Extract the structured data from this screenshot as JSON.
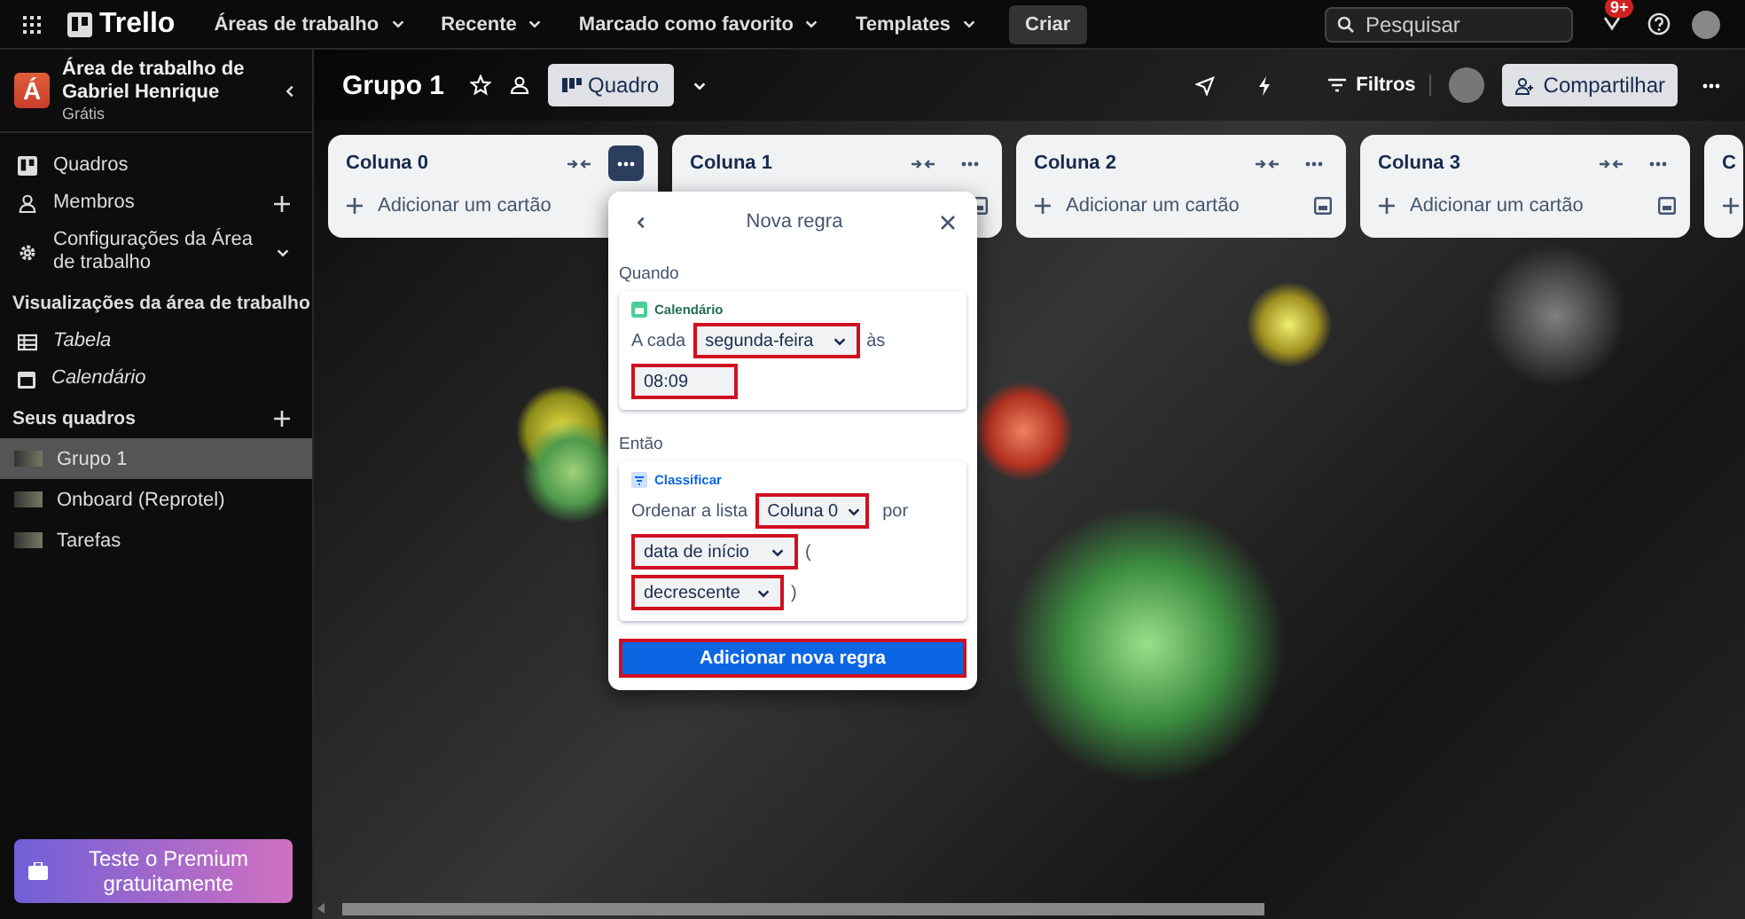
{
  "topbar": {
    "logo": "Trello",
    "menus": [
      {
        "label": "Áreas de trabalho"
      },
      {
        "label": "Recente"
      },
      {
        "label": "Marcado como favorito"
      },
      {
        "label": "Templates"
      }
    ],
    "create": "Criar",
    "search": {
      "placeholder": "Pesquisar"
    },
    "notification_badge": "9+"
  },
  "sidebar": {
    "workspace": {
      "initial": "Á",
      "name": "Área de trabalho de Gabriel Henrique",
      "plan": "Grátis"
    },
    "items": [
      {
        "label": "Quadros"
      },
      {
        "label": "Membros"
      },
      {
        "label": "Configurações da Área de trabalho"
      }
    ],
    "views_title": "Visualizações da área de trabalho",
    "views": [
      {
        "label": "Tabela"
      },
      {
        "label": "Calendário"
      }
    ],
    "boards_title": "Seus quadros",
    "boards": [
      {
        "label": "Grupo 1",
        "selected": true
      },
      {
        "label": "Onboard (Reprotel)",
        "selected": false
      },
      {
        "label": "Tarefas",
        "selected": false
      }
    ],
    "premium": "Teste o Premium gratuitamente"
  },
  "board": {
    "title": "Grupo 1",
    "view": "Quadro",
    "filter": "Filtros",
    "share": "Compartilhar"
  },
  "lists": [
    {
      "title": "Coluna 0",
      "add_card": "Adicionar um cartão",
      "menu_active": true
    },
    {
      "title": "Coluna 1",
      "menu_active": false
    },
    {
      "title": "Coluna 2",
      "add_card": "Adicionar um cartão",
      "menu_active": false
    },
    {
      "title": "Coluna 3",
      "add_card": "Adicionar um cartão",
      "menu_active": false
    },
    {
      "title": "C"
    }
  ],
  "rule_popup": {
    "title": "Nova regra",
    "when_label": "Quando",
    "trigger": {
      "category": "Calendário",
      "prefix": "A cada",
      "day": {
        "value": "segunda-feira",
        "highlighted": true
      },
      "connector": "às",
      "time": {
        "value": "08:09",
        "highlighted": true
      }
    },
    "then_label": "Então",
    "action": {
      "category": "Classificar",
      "prefix": "Ordenar a lista",
      "list": {
        "value": "Coluna 0",
        "highlighted": true
      },
      "connector": "por",
      "field": {
        "value": "data de início",
        "highlighted": true
      },
      "open_paren": "(",
      "order": {
        "value": "decrescente",
        "highlighted": true
      },
      "close_paren": ")"
    },
    "submit": {
      "label": "Adicionar nova regra",
      "highlighted": true
    }
  }
}
